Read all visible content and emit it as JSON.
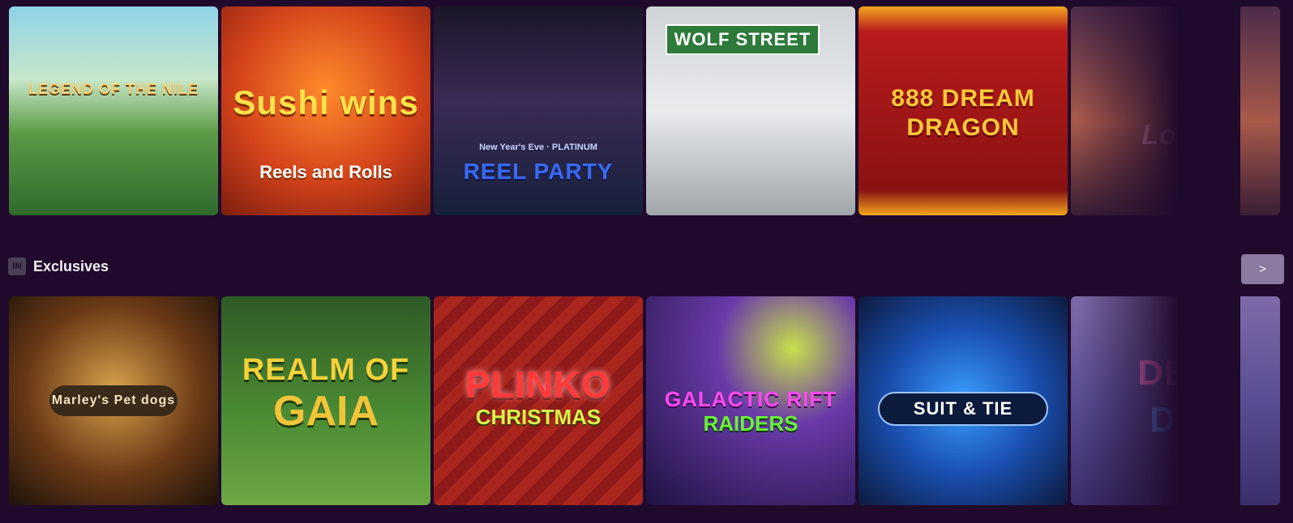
{
  "top_row": [
    {
      "title": "LEGEND OF THE NILE",
      "sub": ""
    },
    {
      "title": "Sushi wins",
      "sub": "Reels and Rolls"
    },
    {
      "title": "REEL PARTY",
      "sub": "New Year's Eve · PLATINUM"
    },
    {
      "title": "WOLF STREET",
      "sub": ""
    },
    {
      "title": "888 DREAM DRAGON",
      "sub": ""
    },
    {
      "title": "Love",
      "sub": ""
    }
  ],
  "section": {
    "icon_text": "IN",
    "title": "Exclusives",
    "prev_label": "<",
    "next_label": ">"
  },
  "bottom_row": [
    {
      "title": "Marley's Pet dogs",
      "sub": ""
    },
    {
      "title": "REALM OF",
      "sub": "GAIA"
    },
    {
      "title": "PLINKO",
      "sub": "CHRISTMAS"
    },
    {
      "title": "GALACTIC RIFT",
      "sub": "RAIDERS"
    },
    {
      "title": "SUIT & TIE",
      "sub": ""
    },
    {
      "title": "DEE",
      "sub": "DA"
    }
  ]
}
